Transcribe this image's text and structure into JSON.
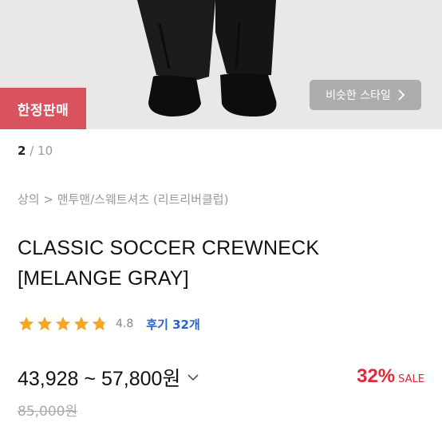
{
  "hero": {
    "limited_badge": "한정판매",
    "similar_style_label": "비슷한 스타일",
    "colors": {
      "badge": "#d9535f",
      "background": "#eae8e6"
    }
  },
  "pager": {
    "current": "2",
    "separator": " / ",
    "total": "10"
  },
  "breadcrumb": "상의 > 맨투맨/스웨트셔츠 (리트리버클럽)",
  "product": {
    "title_line1": "CLASSIC SOCCER CREWNECK",
    "title_line2": "[MELANGE GRAY]",
    "rating": {
      "stars": 4.8,
      "value_label": "4.8",
      "review_label": "후기 32개",
      "star_color": "#f5a623"
    },
    "price": {
      "range_label": "43,928 ~ 57,800",
      "currency": "원",
      "original": "85,000원",
      "discount_pct": "32%",
      "sale_label": "SALE",
      "sale_color": "#e02935"
    }
  }
}
